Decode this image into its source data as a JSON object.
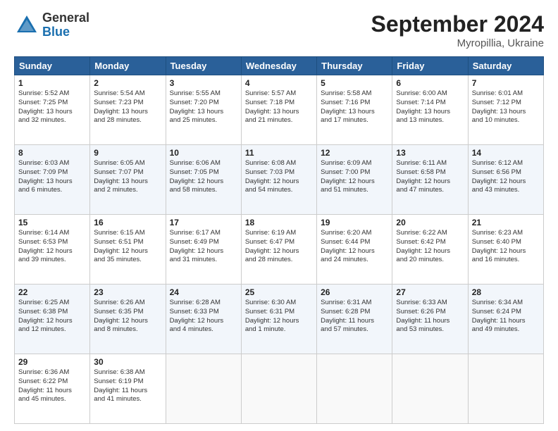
{
  "logo": {
    "general": "General",
    "blue": "Blue"
  },
  "title": "September 2024",
  "location": "Myropillia, Ukraine",
  "headers": [
    "Sunday",
    "Monday",
    "Tuesday",
    "Wednesday",
    "Thursday",
    "Friday",
    "Saturday"
  ],
  "weeks": [
    [
      {
        "day": "1",
        "info": "Sunrise: 5:52 AM\nSunset: 7:25 PM\nDaylight: 13 hours\nand 32 minutes."
      },
      {
        "day": "2",
        "info": "Sunrise: 5:54 AM\nSunset: 7:23 PM\nDaylight: 13 hours\nand 28 minutes."
      },
      {
        "day": "3",
        "info": "Sunrise: 5:55 AM\nSunset: 7:20 PM\nDaylight: 13 hours\nand 25 minutes."
      },
      {
        "day": "4",
        "info": "Sunrise: 5:57 AM\nSunset: 7:18 PM\nDaylight: 13 hours\nand 21 minutes."
      },
      {
        "day": "5",
        "info": "Sunrise: 5:58 AM\nSunset: 7:16 PM\nDaylight: 13 hours\nand 17 minutes."
      },
      {
        "day": "6",
        "info": "Sunrise: 6:00 AM\nSunset: 7:14 PM\nDaylight: 13 hours\nand 13 minutes."
      },
      {
        "day": "7",
        "info": "Sunrise: 6:01 AM\nSunset: 7:12 PM\nDaylight: 13 hours\nand 10 minutes."
      }
    ],
    [
      {
        "day": "8",
        "info": "Sunrise: 6:03 AM\nSunset: 7:09 PM\nDaylight: 13 hours\nand 6 minutes."
      },
      {
        "day": "9",
        "info": "Sunrise: 6:05 AM\nSunset: 7:07 PM\nDaylight: 13 hours\nand 2 minutes."
      },
      {
        "day": "10",
        "info": "Sunrise: 6:06 AM\nSunset: 7:05 PM\nDaylight: 12 hours\nand 58 minutes."
      },
      {
        "day": "11",
        "info": "Sunrise: 6:08 AM\nSunset: 7:03 PM\nDaylight: 12 hours\nand 54 minutes."
      },
      {
        "day": "12",
        "info": "Sunrise: 6:09 AM\nSunset: 7:00 PM\nDaylight: 12 hours\nand 51 minutes."
      },
      {
        "day": "13",
        "info": "Sunrise: 6:11 AM\nSunset: 6:58 PM\nDaylight: 12 hours\nand 47 minutes."
      },
      {
        "day": "14",
        "info": "Sunrise: 6:12 AM\nSunset: 6:56 PM\nDaylight: 12 hours\nand 43 minutes."
      }
    ],
    [
      {
        "day": "15",
        "info": "Sunrise: 6:14 AM\nSunset: 6:53 PM\nDaylight: 12 hours\nand 39 minutes."
      },
      {
        "day": "16",
        "info": "Sunrise: 6:15 AM\nSunset: 6:51 PM\nDaylight: 12 hours\nand 35 minutes."
      },
      {
        "day": "17",
        "info": "Sunrise: 6:17 AM\nSunset: 6:49 PM\nDaylight: 12 hours\nand 31 minutes."
      },
      {
        "day": "18",
        "info": "Sunrise: 6:19 AM\nSunset: 6:47 PM\nDaylight: 12 hours\nand 28 minutes."
      },
      {
        "day": "19",
        "info": "Sunrise: 6:20 AM\nSunset: 6:44 PM\nDaylight: 12 hours\nand 24 minutes."
      },
      {
        "day": "20",
        "info": "Sunrise: 6:22 AM\nSunset: 6:42 PM\nDaylight: 12 hours\nand 20 minutes."
      },
      {
        "day": "21",
        "info": "Sunrise: 6:23 AM\nSunset: 6:40 PM\nDaylight: 12 hours\nand 16 minutes."
      }
    ],
    [
      {
        "day": "22",
        "info": "Sunrise: 6:25 AM\nSunset: 6:38 PM\nDaylight: 12 hours\nand 12 minutes."
      },
      {
        "day": "23",
        "info": "Sunrise: 6:26 AM\nSunset: 6:35 PM\nDaylight: 12 hours\nand 8 minutes."
      },
      {
        "day": "24",
        "info": "Sunrise: 6:28 AM\nSunset: 6:33 PM\nDaylight: 12 hours\nand 4 minutes."
      },
      {
        "day": "25",
        "info": "Sunrise: 6:30 AM\nSunset: 6:31 PM\nDaylight: 12 hours\nand 1 minute."
      },
      {
        "day": "26",
        "info": "Sunrise: 6:31 AM\nSunset: 6:28 PM\nDaylight: 11 hours\nand 57 minutes."
      },
      {
        "day": "27",
        "info": "Sunrise: 6:33 AM\nSunset: 6:26 PM\nDaylight: 11 hours\nand 53 minutes."
      },
      {
        "day": "28",
        "info": "Sunrise: 6:34 AM\nSunset: 6:24 PM\nDaylight: 11 hours\nand 49 minutes."
      }
    ],
    [
      {
        "day": "29",
        "info": "Sunrise: 6:36 AM\nSunset: 6:22 PM\nDaylight: 11 hours\nand 45 minutes."
      },
      {
        "day": "30",
        "info": "Sunrise: 6:38 AM\nSunset: 6:19 PM\nDaylight: 11 hours\nand 41 minutes."
      },
      {
        "day": "",
        "info": ""
      },
      {
        "day": "",
        "info": ""
      },
      {
        "day": "",
        "info": ""
      },
      {
        "day": "",
        "info": ""
      },
      {
        "day": "",
        "info": ""
      }
    ]
  ]
}
